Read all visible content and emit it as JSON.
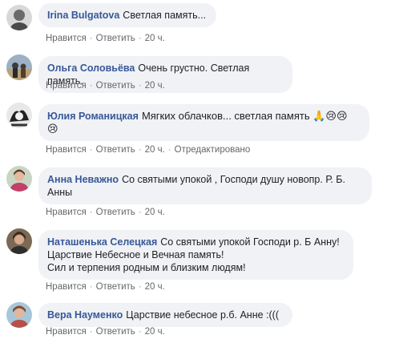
{
  "comments": [
    {
      "author": "Irina Bulgatova",
      "text": "Светлая память...",
      "actions": {
        "like": "Нравится",
        "reply": "Ответить",
        "time": "20 ч."
      }
    },
    {
      "author": "Ольга Соловьёва",
      "text": "Очень грустно. Светлая память.",
      "actions": {
        "like": "Нравится",
        "reply": "Ответить",
        "time": "20 ч."
      }
    },
    {
      "author": "Юлия Романицкая",
      "text": "Мягких облачков... светлая память 🙏😢😢",
      "text_line2": "😢",
      "actions": {
        "like": "Нравится",
        "reply": "Ответить",
        "time": "20 ч.",
        "edited": "Отредактировано"
      }
    },
    {
      "author": "Анна Неважно",
      "text": "Со святыми упокой , Господи душу новопр. Р. Б.",
      "text_line2": "Анны",
      "actions": {
        "like": "Нравится",
        "reply": "Ответить",
        "time": "20 ч."
      }
    },
    {
      "author": "Наташенька Селецкая",
      "text": "Со святыми упокой Господи р. Б Анну!",
      "text_line2": "Царствие Небесное и Вечная память!",
      "text_line3": "Сил и терпения родным и близким людям!",
      "actions": {
        "like": "Нравится",
        "reply": "Ответить",
        "time": "20 ч."
      }
    },
    {
      "author": "Вера Науменко",
      "text": "Царствие небесное р.б. Анне :(((",
      "actions": {
        "like": "Нравится",
        "reply": "Ответить",
        "time": "20 ч."
      }
    }
  ],
  "colors": {
    "author": "#385898",
    "bubble": "#f0f2f5",
    "meta": "#65676b"
  }
}
